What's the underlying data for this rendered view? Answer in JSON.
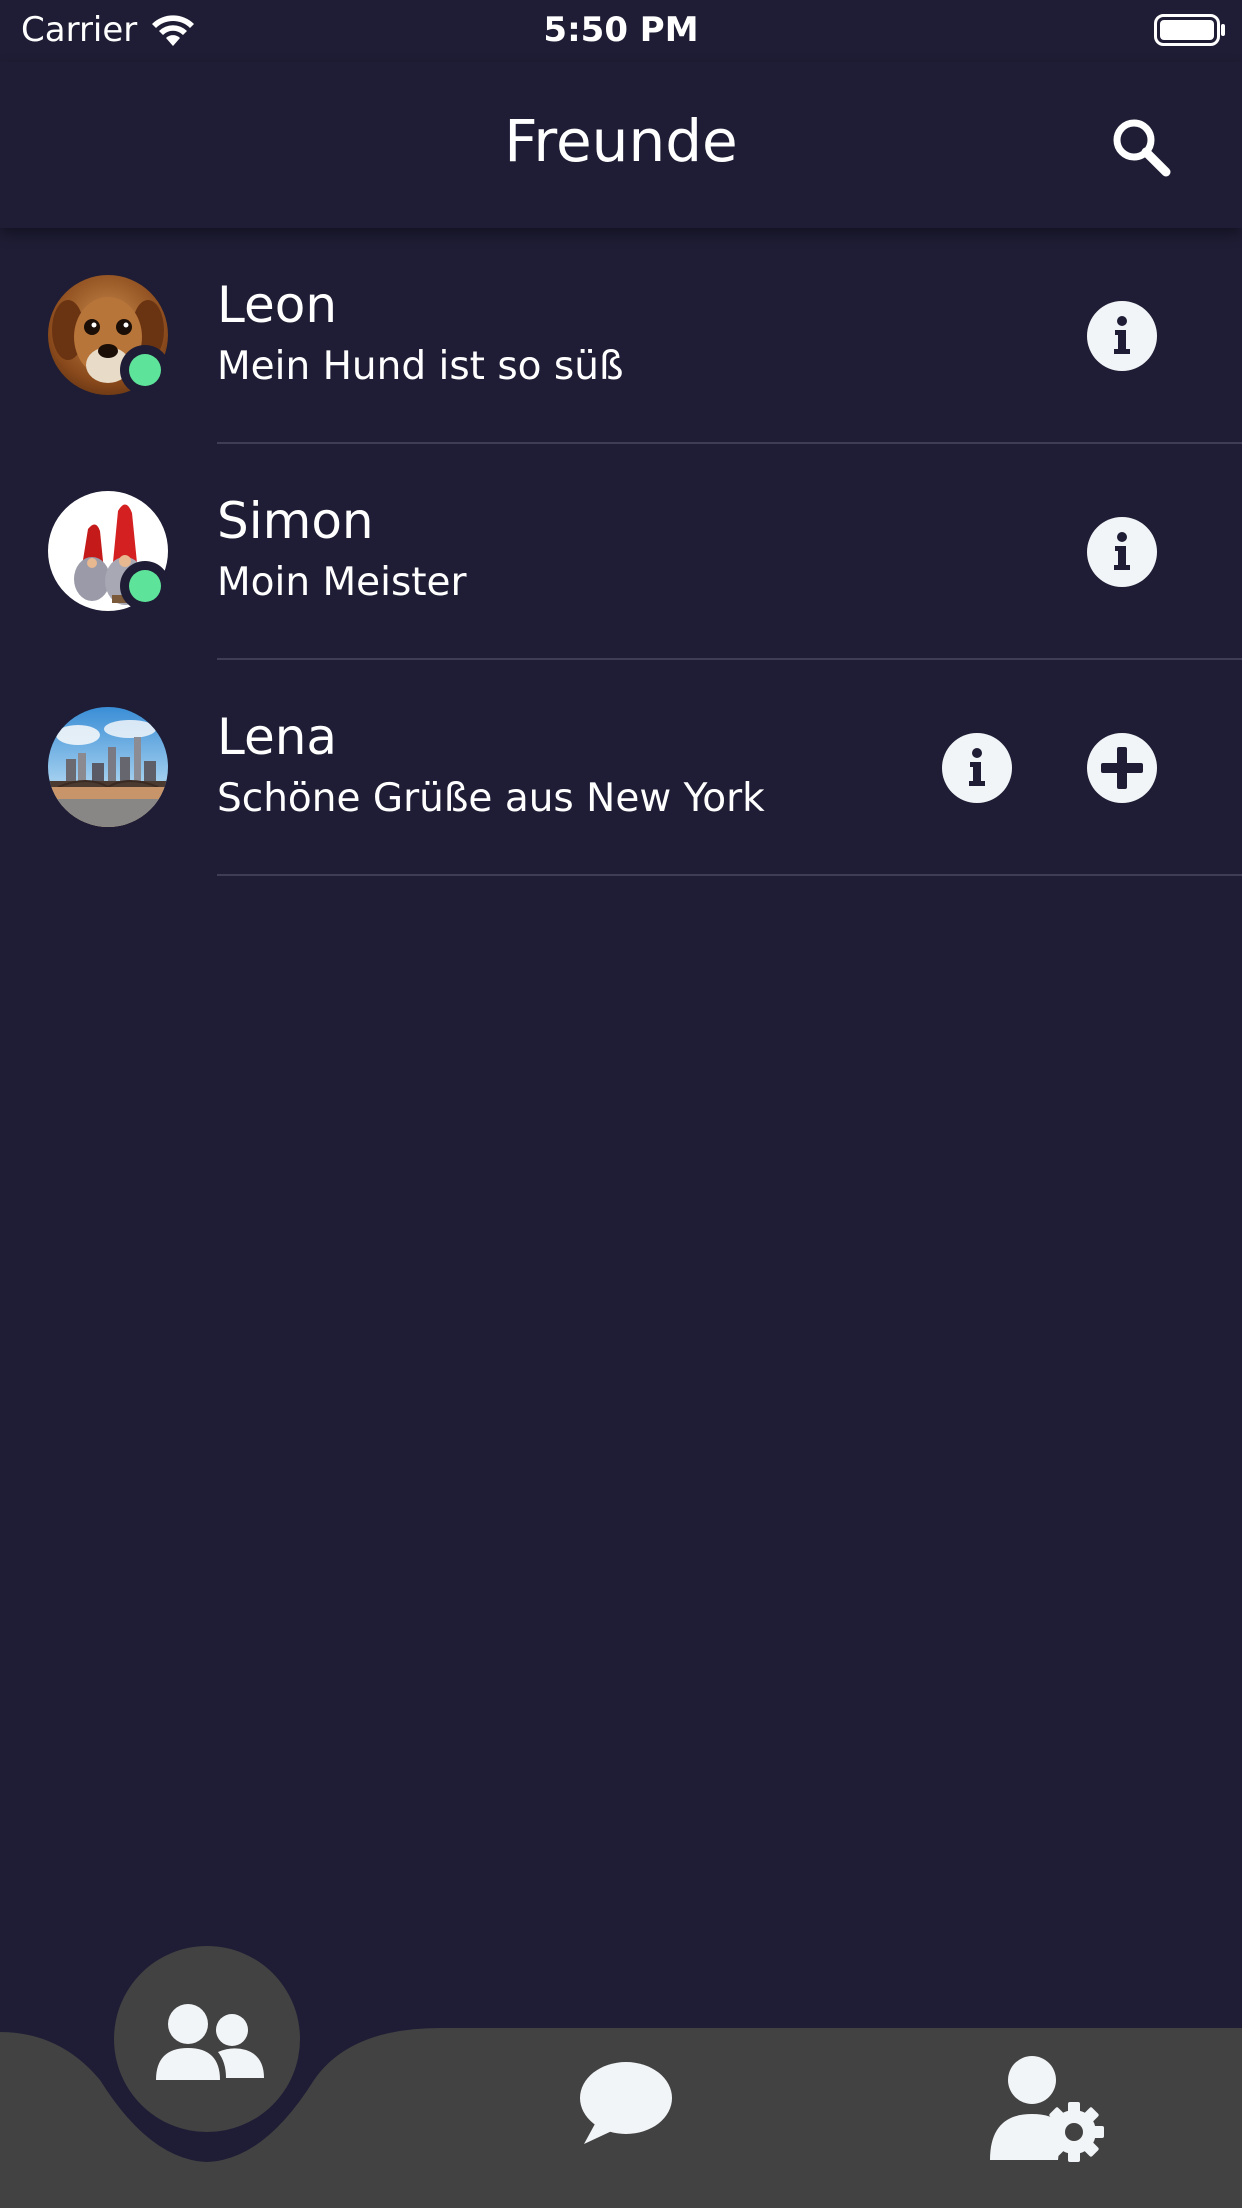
{
  "status_bar": {
    "carrier": "Carrier",
    "time": "5:50 PM"
  },
  "header": {
    "title": "Freunde",
    "search_icon": "search-icon"
  },
  "friends": [
    {
      "name": "Leon",
      "status": "Mein Hund ist so süß",
      "online": true,
      "avatar": "dog-photo",
      "actions": [
        "info"
      ]
    },
    {
      "name": "Simon",
      "status": "Moin Meister",
      "online": true,
      "avatar": "gnomes-photo",
      "actions": [
        "info"
      ]
    },
    {
      "name": "Lena",
      "status": "Schöne Grüße aus New York",
      "online": false,
      "avatar": "new-york-skyline-photo",
      "actions": [
        "info",
        "add"
      ]
    }
  ],
  "bottom_nav": {
    "items": [
      {
        "icon": "friends-icon",
        "active": true
      },
      {
        "icon": "chat-bubble-icon",
        "active": false
      },
      {
        "icon": "user-settings-icon",
        "active": false
      }
    ]
  },
  "colors": {
    "background": "#1e1d35",
    "nav_bar": "#424242",
    "online": "#5ee39a",
    "icon_fill": "#f2f5f7"
  }
}
